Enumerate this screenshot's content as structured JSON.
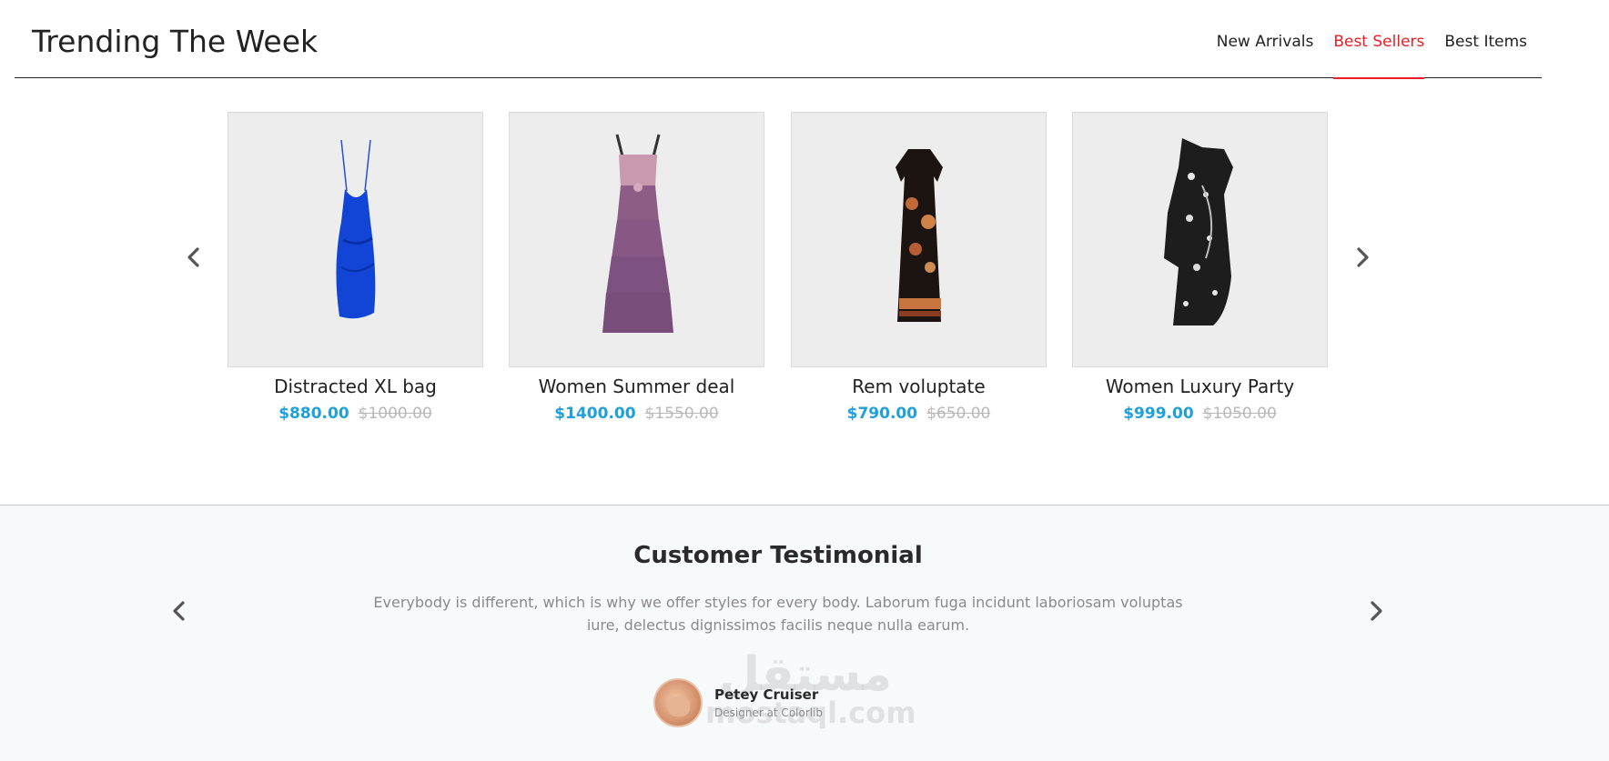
{
  "header": {
    "title": "Trending The Week",
    "tabs": [
      {
        "label": "New Arrivals",
        "active": false
      },
      {
        "label": "Best Sellers",
        "active": true
      },
      {
        "label": "Best Items",
        "active": false
      }
    ]
  },
  "products": [
    {
      "name": "Distracted XL bag",
      "price": "$880.00",
      "old_price": "$1000.00",
      "image": "blue-slip-dress"
    },
    {
      "name": "Women Summer deal",
      "price": "$1400.00",
      "old_price": "$1550.00",
      "image": "purple-tiered-dress"
    },
    {
      "name": "Rem voluptate",
      "price": "$790.00",
      "old_price": "$650.00",
      "image": "floral-black-dress"
    },
    {
      "name": "Women Luxury Party",
      "price": "$999.00",
      "old_price": "$1050.00",
      "image": "patterned-one-shoulder-dress"
    }
  ],
  "testimonial": {
    "title": "Customer Testimonial",
    "body": "Everybody is different, which is why we offer styles for every body. Laborum fuga incidunt laboriosam voluptas iure, delectus dignissimos facilis neque nulla earum.",
    "author_name": "Petey Cruiser",
    "author_role": "Designer at Colorlib"
  },
  "watermark": {
    "arabic": "مستقل",
    "latin": "mostaql.com"
  },
  "colors": {
    "accent": "#ec1c24",
    "price": "#1ea0dc",
    "old_price": "#b8b8b8"
  }
}
